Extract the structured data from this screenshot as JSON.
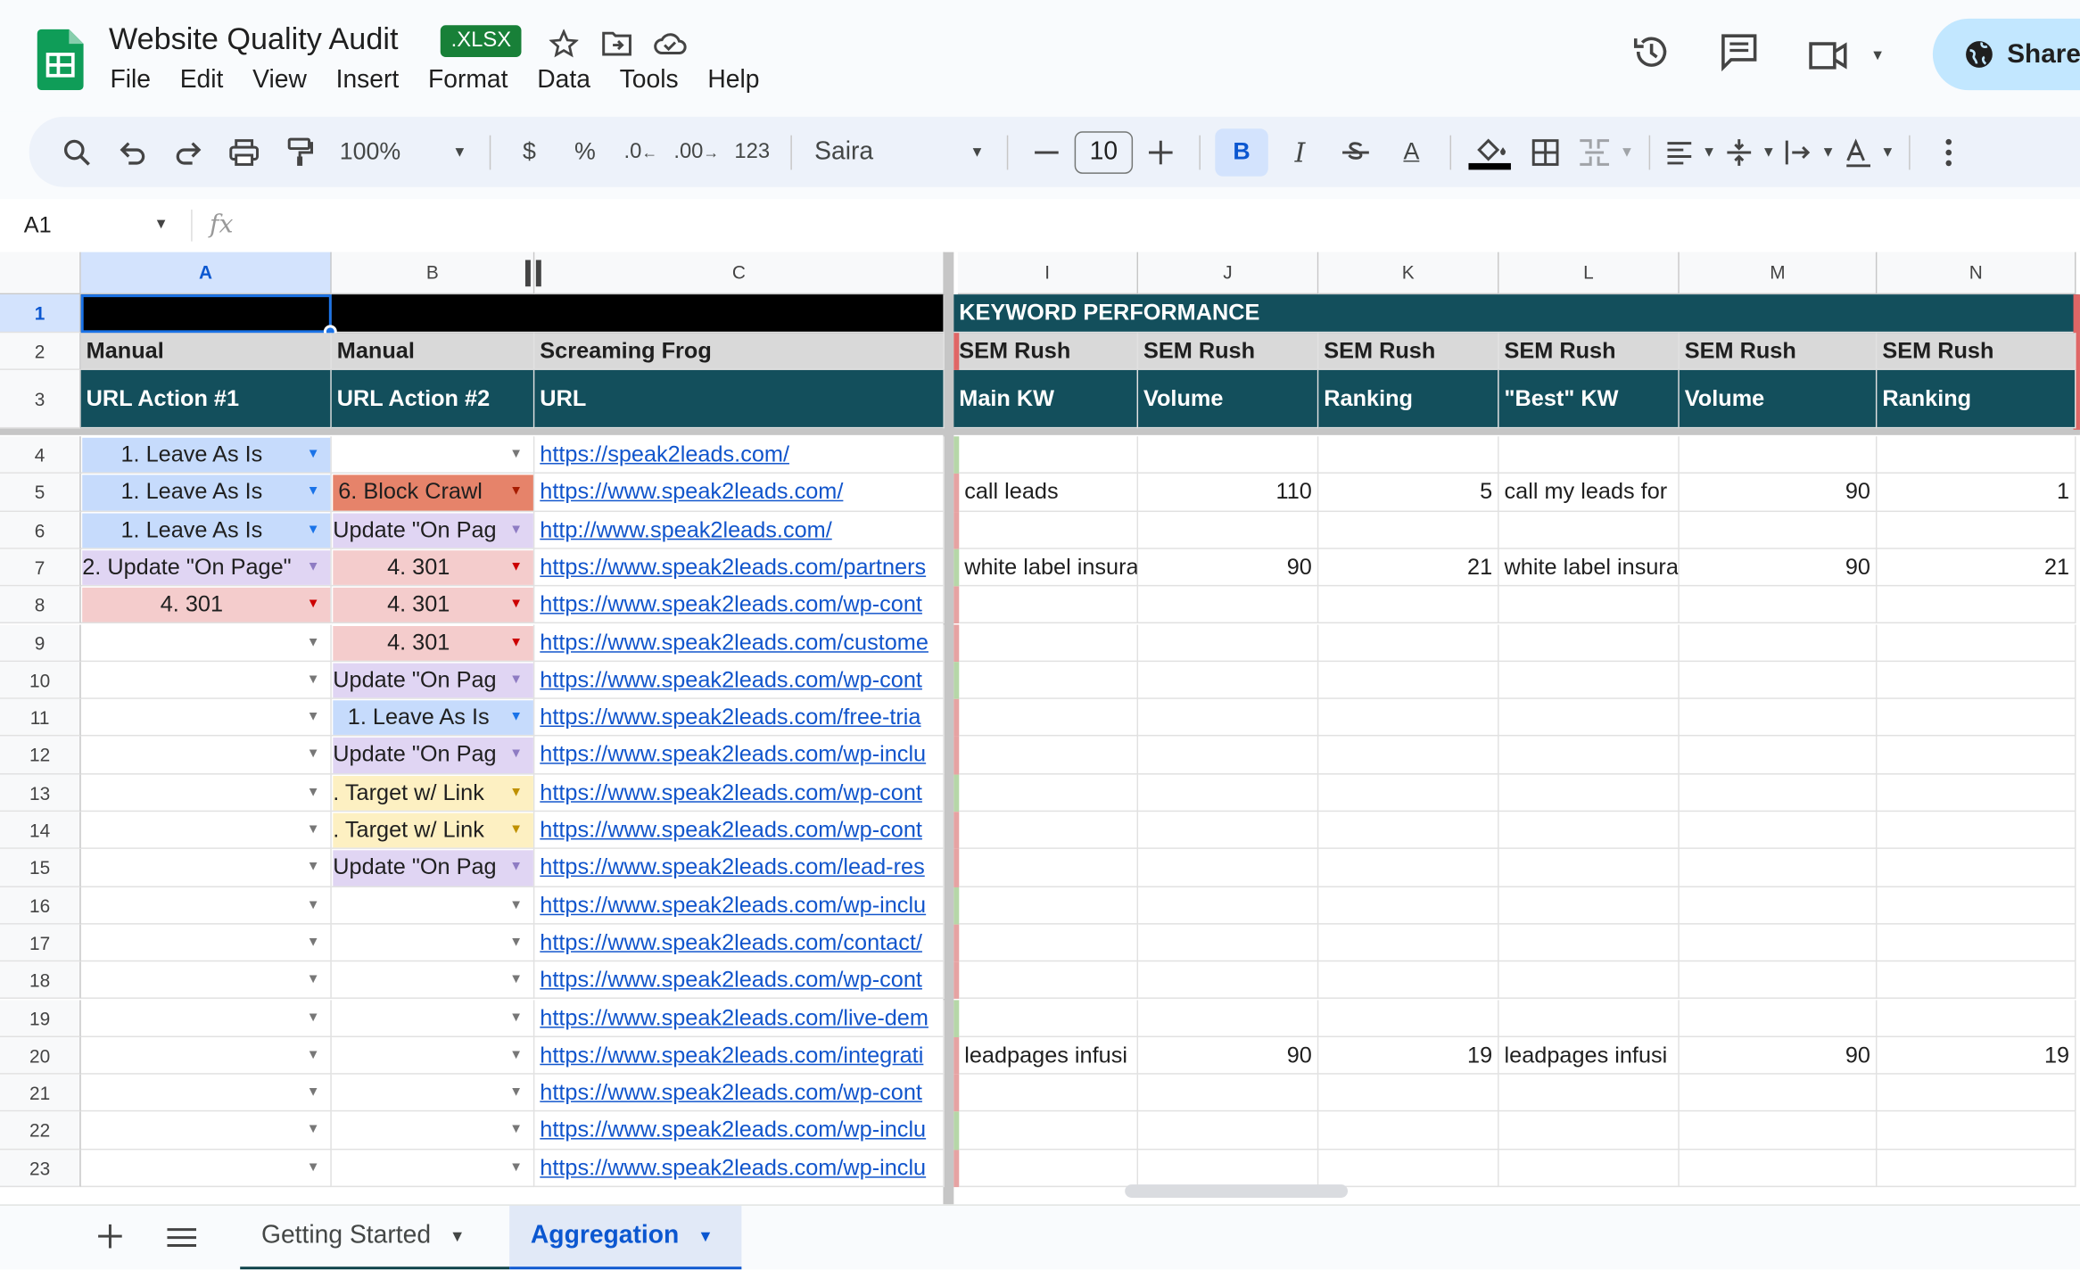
{
  "doc": {
    "title": "Website Quality Audit",
    "badge": ".XLSX"
  },
  "menu": [
    "File",
    "Edit",
    "View",
    "Insert",
    "Format",
    "Data",
    "Tools",
    "Help"
  ],
  "share_label": "Share",
  "toolbar": {
    "zoom": "100%",
    "currency": "$",
    "percent": "%",
    "dec_less": ".0",
    "dec_more": ".00",
    "number_format": "123",
    "font": "Saira",
    "font_size": "10",
    "bold": "B",
    "italic": "I",
    "text_color": "A"
  },
  "formula_bar": {
    "cell_ref": "A1",
    "fx": "fx"
  },
  "columns": [
    {
      "key": "A",
      "label": "A"
    },
    {
      "key": "B",
      "label": "B"
    },
    {
      "key": "C",
      "label": "C"
    },
    {
      "key": "I",
      "label": "I"
    },
    {
      "key": "J",
      "label": "J"
    },
    {
      "key": "K",
      "label": "K"
    },
    {
      "key": "L",
      "label": "L"
    },
    {
      "key": "M",
      "label": "M"
    },
    {
      "key": "N",
      "label": "N"
    }
  ],
  "header_rows": {
    "row1": {
      "I": "KEYWORD PERFORMANCE"
    },
    "row2": {
      "A": "Manual",
      "B": "Manual",
      "C": "Screaming Frog",
      "I": "SEM Rush",
      "J": "SEM Rush",
      "K": "SEM Rush",
      "L": "SEM Rush",
      "M": "SEM Rush",
      "N": "SEM Rush"
    },
    "row3": {
      "A": "URL Action #1",
      "B": "URL Action #2",
      "C": "URL",
      "I": "Main KW",
      "J": "Volume",
      "K": "Ranking",
      "L": "\"Best\"  KW",
      "M": "Volume",
      "N": "Ranking"
    }
  },
  "data_rows": [
    {
      "n": "4",
      "A": "1. Leave As Is",
      "B": "",
      "C": "https://speak2leads.com/",
      "I": "",
      "J": "",
      "K": "",
      "L": "",
      "M": "",
      "N": ""
    },
    {
      "n": "5",
      "A": "1. Leave As Is",
      "B": "6. Block Crawl",
      "C": "https://www.speak2leads.com/",
      "I": "call leads",
      "J": "110",
      "K": "5",
      "L": "call my leads for",
      "M": "90",
      "N": "1"
    },
    {
      "n": "6",
      "A": "1. Leave As Is",
      "B": "Update \"On Pag",
      "C": "http://www.speak2leads.com/",
      "I": "",
      "J": "",
      "K": "",
      "L": "",
      "M": "",
      "N": ""
    },
    {
      "n": "7",
      "A": "2. Update \"On Page\"",
      "B": "4. 301",
      "C": "https://www.speak2leads.com/partners",
      "I": "white label insura",
      "J": "90",
      "K": "21",
      "L": "white label insura",
      "M": "90",
      "N": "21"
    },
    {
      "n": "8",
      "A": "4. 301",
      "B": "4. 301",
      "C": "https://www.speak2leads.com/wp-cont",
      "I": "",
      "J": "",
      "K": "",
      "L": "",
      "M": "",
      "N": ""
    },
    {
      "n": "9",
      "A": "",
      "B": "4. 301",
      "C": "https://www.speak2leads.com/custome",
      "I": "",
      "J": "",
      "K": "",
      "L": "",
      "M": "",
      "N": ""
    },
    {
      "n": "10",
      "A": "",
      "B": "Update \"On Pag",
      "C": "https://www.speak2leads.com/wp-cont",
      "I": "",
      "J": "",
      "K": "",
      "L": "",
      "M": "",
      "N": ""
    },
    {
      "n": "11",
      "A": "",
      "B": "1. Leave As Is",
      "C": "https://www.speak2leads.com/free-tria",
      "I": "",
      "J": "",
      "K": "",
      "L": "",
      "M": "",
      "N": ""
    },
    {
      "n": "12",
      "A": "",
      "B": "Update \"On Pag",
      "C": "https://www.speak2leads.com/wp-inclu",
      "I": "",
      "J": "",
      "K": "",
      "L": "",
      "M": "",
      "N": ""
    },
    {
      "n": "13",
      "A": "",
      "B": ". Target w/ Link",
      "C": "https://www.speak2leads.com/wp-cont",
      "I": "",
      "J": "",
      "K": "",
      "L": "",
      "M": "",
      "N": ""
    },
    {
      "n": "14",
      "A": "",
      "B": ". Target w/ Link",
      "C": "https://www.speak2leads.com/wp-cont",
      "I": "",
      "J": "",
      "K": "",
      "L": "",
      "M": "",
      "N": ""
    },
    {
      "n": "15",
      "A": "",
      "B": "Update \"On Pag",
      "C": "https://www.speak2leads.com/lead-res",
      "I": "",
      "J": "",
      "K": "",
      "L": "",
      "M": "",
      "N": ""
    },
    {
      "n": "16",
      "A": "",
      "B": "",
      "C": "https://www.speak2leads.com/wp-inclu",
      "I": "",
      "J": "",
      "K": "",
      "L": "",
      "M": "",
      "N": ""
    },
    {
      "n": "17",
      "A": "",
      "B": "",
      "C": "https://www.speak2leads.com/contact/",
      "I": "",
      "J": "",
      "K": "",
      "L": "",
      "M": "",
      "N": ""
    },
    {
      "n": "18",
      "A": "",
      "B": "",
      "C": "https://www.speak2leads.com/wp-cont",
      "I": "",
      "J": "",
      "K": "",
      "L": "",
      "M": "",
      "N": ""
    },
    {
      "n": "19",
      "A": "",
      "B": "",
      "C": "https://www.speak2leads.com/live-dem",
      "I": "",
      "J": "",
      "K": "",
      "L": "",
      "M": "",
      "N": ""
    },
    {
      "n": "20",
      "A": "",
      "B": "",
      "C": "https://www.speak2leads.com/integrati",
      "I": "leadpages infusi",
      "J": "90",
      "K": "19",
      "L": "leadpages infusi",
      "M": "90",
      "N": "19"
    },
    {
      "n": "21",
      "A": "",
      "B": "",
      "C": "https://www.speak2leads.com/wp-cont",
      "I": "",
      "J": "",
      "K": "",
      "L": "",
      "M": "",
      "N": ""
    },
    {
      "n": "22",
      "A": "",
      "B": "",
      "C": "https://www.speak2leads.com/wp-inclu",
      "I": "",
      "J": "",
      "K": "",
      "L": "",
      "M": "",
      "N": ""
    },
    {
      "n": "23",
      "A": "",
      "B": "",
      "C": "https://www.speak2leads.com/wp-inclu",
      "I": "",
      "J": "",
      "K": "",
      "L": "",
      "M": "",
      "N": ""
    }
  ],
  "row_numbers_header": [
    "1",
    "2",
    "3"
  ],
  "chip_colors": {
    "leave": "#c6dbfc",
    "update": "#e0d5f3",
    "block": "#e6836a",
    "r301": "#f4cccc",
    "target": "#fdf0c2"
  },
  "sheets": [
    {
      "name": "Getting Started",
      "active": false
    },
    {
      "name": "Aggregation",
      "active": true
    }
  ]
}
